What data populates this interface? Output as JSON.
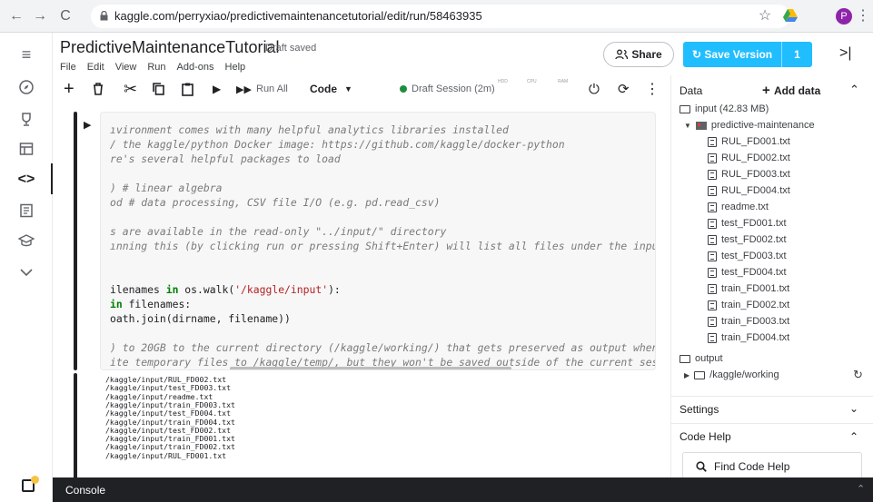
{
  "browser": {
    "url": "kaggle.com/perryxiao/predictivemaintenancetutorial/edit/run/58463935",
    "avatar_letter": "P"
  },
  "header": {
    "title": "PredictiveMaintenanceTutorial",
    "status": "Draft saved",
    "menu": [
      "File",
      "Edit",
      "View",
      "Run",
      "Add-ons",
      "Help"
    ],
    "share_label": "Share",
    "save_label": "Save Version",
    "save_count": "1"
  },
  "toolbar": {
    "run_all_label": "Run All",
    "cell_type": "Code",
    "session": "Draft Session (2m)",
    "meters": [
      "HDD",
      "CPU",
      "RAM"
    ]
  },
  "code_cell": {
    "lines": [
      {
        "text": "ıvironment comes with many helpful analytics libraries installed",
        "kind": "cm"
      },
      {
        "text": "/ the kaggle/python Docker image: https://github.com/kaggle/docker-python",
        "kind": "cm"
      },
      {
        "text": "re's several helpful packages to load",
        "kind": "cm"
      },
      {
        "text": "",
        "kind": "cm"
      },
      {
        "text": ") # linear algebra",
        "kind": "cm"
      },
      {
        "text": "od # data processing, CSV file I/O (e.g. pd.read_csv)",
        "kind": "cm"
      },
      {
        "text": "",
        "kind": "cm"
      },
      {
        "text": "s are available in the read-only \"../input/\" directory",
        "kind": "cm"
      },
      {
        "text": "ınning this (by clicking run or pressing Shift+Enter) will list all files under the input direct",
        "kind": "cm"
      },
      {
        "text": "",
        "kind": "cm"
      },
      {
        "text": "",
        "kind": "cm"
      },
      {
        "text": "ilenames in os.walk('/kaggle/input'):",
        "kind": "code1"
      },
      {
        "text": "in filenames:",
        "kind": "code2"
      },
      {
        "text": "oath.join(dirname, filename))",
        "kind": "plain"
      },
      {
        "text": "",
        "kind": "cm"
      },
      {
        "text": ") to 20GB to the current directory (/kaggle/working/) that gets preserved as output when you cr",
        "kind": "cm"
      },
      {
        "text": "ite temporary files to /kaggle/temp/, but they won't be saved outside of the current session",
        "kind": "cm"
      }
    ]
  },
  "output_cell": {
    "lines": [
      "/kaggle/input/RUL_FD002.txt",
      "/kaggle/input/test_FD003.txt",
      "/kaggle/input/readme.txt",
      "/kaggle/input/train_FD003.txt",
      "/kaggle/input/test_FD004.txt",
      "/kaggle/input/train_FD004.txt",
      "/kaggle/input/test_FD002.txt",
      "/kaggle/input/train_FD001.txt",
      "/kaggle/input/train_FD002.txt",
      "/kaggle/input/RUL_FD001.txt"
    ]
  },
  "right_panel": {
    "data_label": "Data",
    "add_data_label": "Add data",
    "input_label": "input (42.83 MB)",
    "dataset_label": "predictive-maintenance",
    "files": [
      "RUL_FD001.txt",
      "RUL_FD002.txt",
      "RUL_FD003.txt",
      "RUL_FD004.txt",
      "readme.txt",
      "test_FD001.txt",
      "test_FD002.txt",
      "test_FD003.txt",
      "test_FD004.txt",
      "train_FD001.txt",
      "train_FD002.txt",
      "train_FD003.txt",
      "train_FD004.txt"
    ],
    "output_label": "output",
    "working_label": "/kaggle/working",
    "settings_label": "Settings",
    "code_help_label": "Code Help",
    "find_help_label": "Find Code Help"
  },
  "console": {
    "label": "Console"
  },
  "colors": {
    "accent": "#20beff",
    "session_dot": "#1e8e3e"
  }
}
